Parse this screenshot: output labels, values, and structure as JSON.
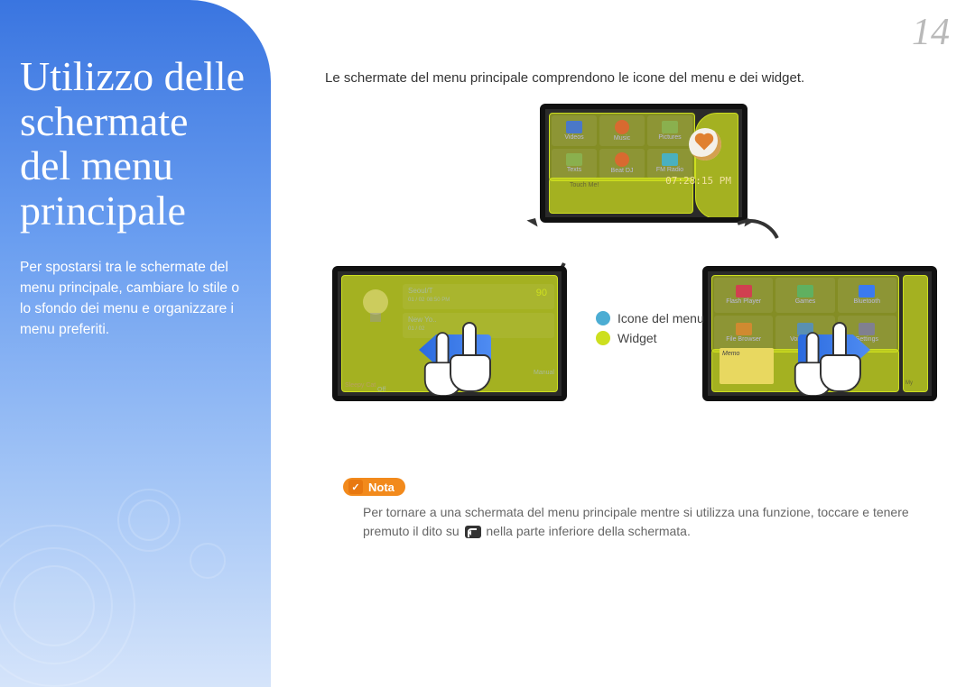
{
  "page_number": "14",
  "sidebar": {
    "title": "Utilizzo delle schermate del menu principale",
    "subtitle": "Per spostarsi tra le schermate del menu principale, cambiare lo stile o lo sfondo dei menu e organizzare i menu preferiti."
  },
  "intro": "Le schermate del menu principale comprendono le icone del menu e dei widget.",
  "legend": {
    "menu": "Icone del menu",
    "widget": "Widget"
  },
  "note": {
    "label": "Nota",
    "text_a": "Per tornare a una schermata del menu principale mentre si utilizza una funzione, toccare e tenere premuto il dito su ",
    "text_b": " nella parte inferiore della schermata."
  },
  "screens": {
    "top": {
      "apps": [
        "Videos",
        "Music",
        "Pictures",
        "Texts",
        "Beat DJ",
        "FM Radio"
      ],
      "clock": "07:28:15 PM",
      "touch": "Touch Me!"
    },
    "left": {
      "city1": "Seoul/T",
      "date1": "01 / 02",
      "time1": "08:50 PM",
      "city2": "New Yo..",
      "date2": "01 / 02",
      "temp": "90",
      "freq": "106.5MHz",
      "off": "Off",
      "sleepy": "Sleepy Cat",
      "manual": "Manual"
    },
    "right": {
      "apps": [
        "Flash Player",
        "Games",
        "Bluetooth",
        "File Browser",
        "Voice REC",
        "Settings"
      ],
      "memo": "Memo",
      "my": "My"
    }
  },
  "colors": {
    "accent_orange": "#f28a1c",
    "legend_menu": "#4cadd3",
    "legend_widget": "#cddf1f"
  }
}
